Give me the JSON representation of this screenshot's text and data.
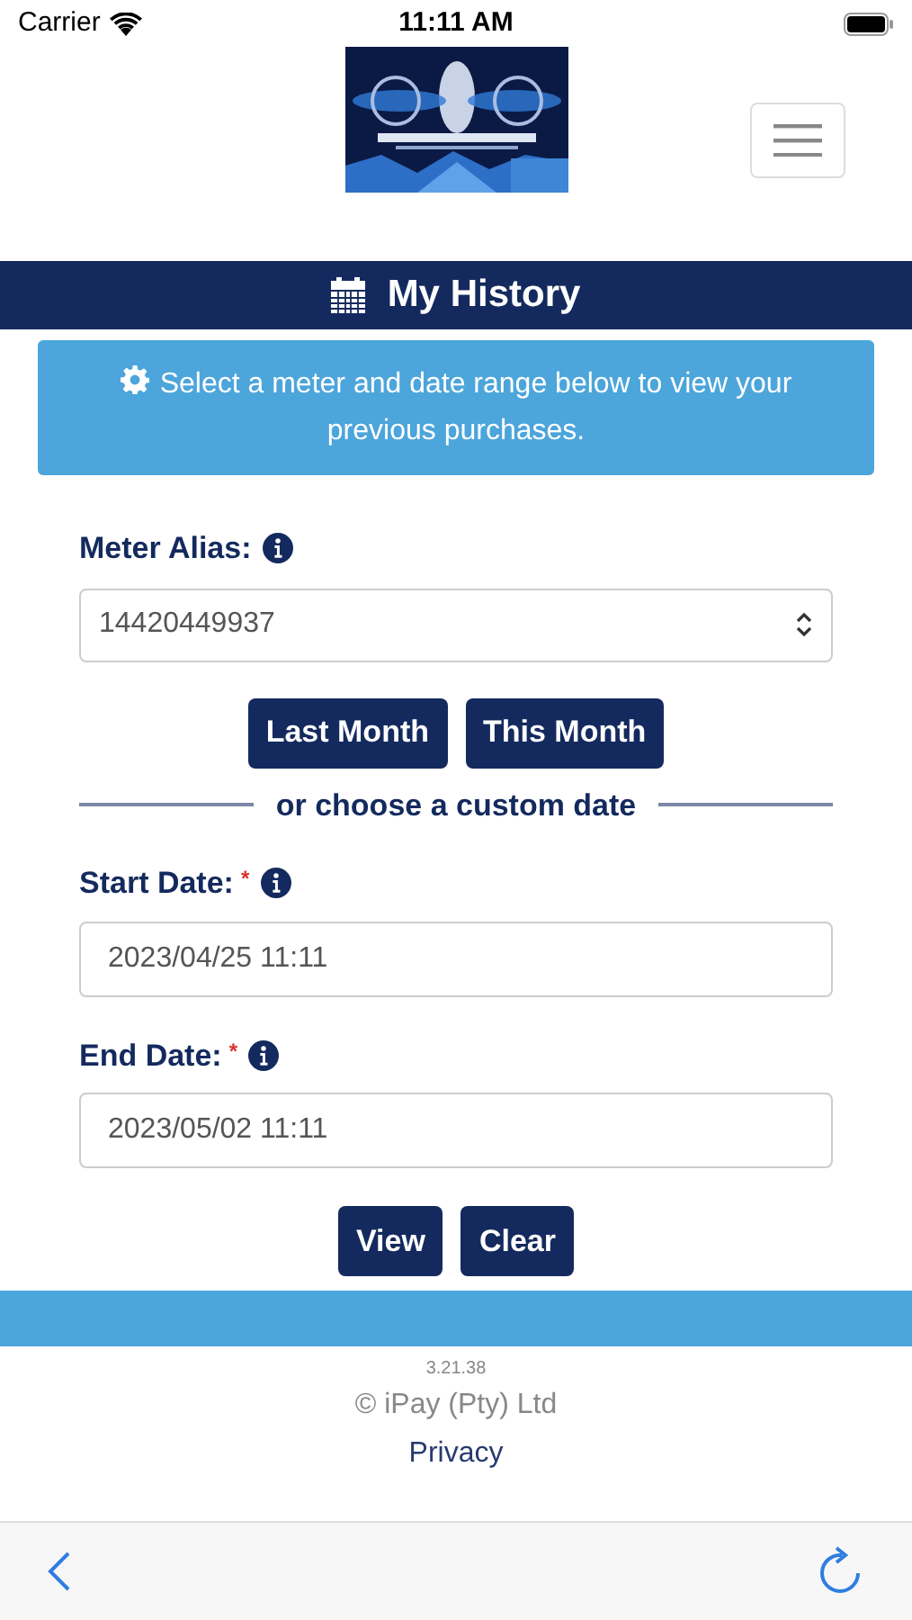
{
  "status_bar": {
    "carrier": "Carrier",
    "time": "11:11 AM"
  },
  "title_bar": {
    "title": "My History"
  },
  "info": {
    "text": "Select a meter and date range below to view your previous purchases."
  },
  "meter": {
    "label": "Meter Alias:",
    "value": "14420449937"
  },
  "quick_buttons": [
    "Last Month",
    "This Month"
  ],
  "divider_text": "or choose a custom date",
  "date_fields": [
    {
      "label": "Start Date:",
      "required_mark": "*",
      "value": "2023/04/25 11:11"
    },
    {
      "label": "End Date:",
      "required_mark": "*",
      "value": "2023/05/02 11:11"
    }
  ],
  "action_buttons": [
    "View",
    "Clear"
  ],
  "footer": {
    "version": "3.21.38",
    "copyright": "© iPay (Pty) Ltd",
    "link": "Privacy"
  }
}
